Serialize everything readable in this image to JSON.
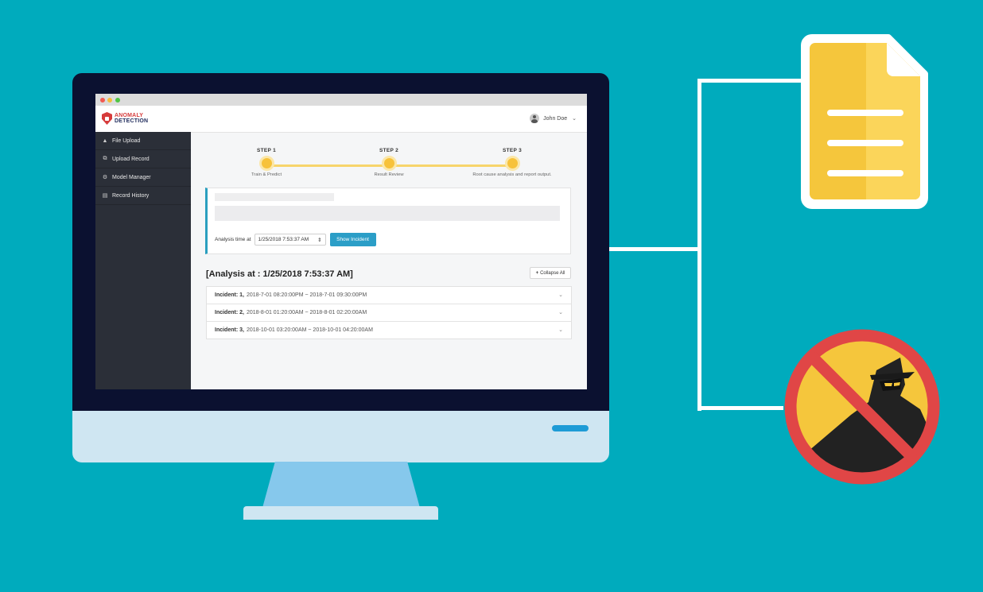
{
  "app": {
    "logo_line1": "ANOMALY",
    "logo_line2": "DETECTION",
    "user_name": "John Doe"
  },
  "sidebar": {
    "items": [
      {
        "label": "File Upload",
        "icon": "upload-icon"
      },
      {
        "label": "Upload Record",
        "icon": "copy-icon"
      },
      {
        "label": "Model Manager",
        "icon": "gears-icon"
      },
      {
        "label": "Record History",
        "icon": "document-icon"
      }
    ]
  },
  "steps": [
    {
      "num": "STEP 1",
      "caption": "Train & Predict"
    },
    {
      "num": "STEP 2",
      "caption": "Result Review"
    },
    {
      "num": "STEP 3",
      "caption": "Root cause analysis and report output."
    }
  ],
  "form": {
    "analysis_label": "Analysis time at",
    "selected_time": "1/25/2018 7:53:37 AM",
    "show_button": "Show Incident"
  },
  "results": {
    "title": "[Analysis at : 1/25/2018 7:53:37 AM]",
    "collapse_label": "Collapse All",
    "incidents": [
      {
        "label": "Incident: 1,",
        "range": "2018-7-01 08:20:00PM ~ 2018-7-01 09:30:00PM"
      },
      {
        "label": "Incident: 2,",
        "range": "2018-8-01 01:20:00AM ~ 2018-8-01 02:20:00AM"
      },
      {
        "label": "Incident: 3,",
        "range": "2018-10-01 03:20:00AM ~ 2018-10-01 04:20:00AM"
      }
    ]
  },
  "colors": {
    "background": "#00abbd",
    "accent_blue": "#2b9ec7",
    "step_yellow": "#f7c23a",
    "sidebar_dark": "#2b2f38",
    "doc_yellow": "#f5c63c",
    "forbidden_red": "#e04646"
  }
}
